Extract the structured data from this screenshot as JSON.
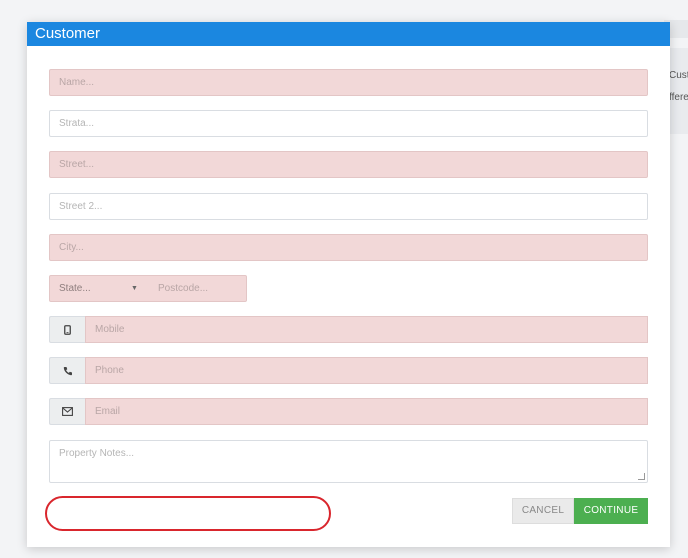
{
  "modal": {
    "title": "Customer"
  },
  "background": {
    "line1": "Custo",
    "line2": "fferen"
  },
  "form": {
    "name_placeholder": "Name...",
    "strata_placeholder": "Strata...",
    "street_placeholder": "Street...",
    "street2_placeholder": "Street 2...",
    "city_placeholder": "City...",
    "state_placeholder": "State...",
    "postcode_placeholder": "Postcode...",
    "mobile_placeholder": "Mobile",
    "phone_placeholder": "Phone",
    "email_placeholder": "Email",
    "notes_placeholder": "Property Notes..."
  },
  "icons": {
    "mobile": "mobile-icon",
    "phone": "phone-icon",
    "email": "envelope-icon",
    "state_caret": "caret-down-icon"
  },
  "actions": {
    "cancel_label": "CANCEL",
    "continue_label": "CONTINUE"
  },
  "colors": {
    "header": "#1b87e0",
    "invalid_field": "#f2d8d8",
    "continue": "#4caf50",
    "annotation": "#d9262d"
  }
}
